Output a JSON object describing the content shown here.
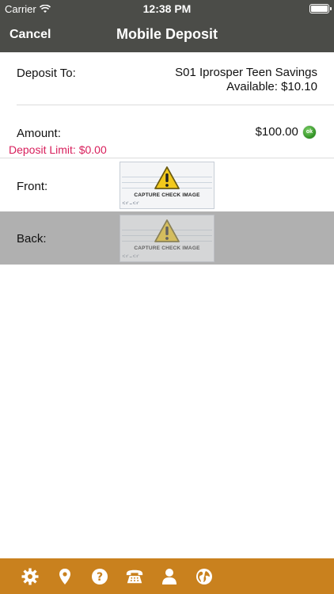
{
  "status": {
    "carrier": "Carrier",
    "time": "12:38 PM"
  },
  "nav": {
    "cancel_label": "Cancel",
    "title": "Mobile Deposit"
  },
  "deposit": {
    "label": "Deposit To:",
    "account": "S01 Iprosper Teen Savings",
    "available": "Available: $10.10"
  },
  "amount": {
    "label": "Amount:",
    "value": "$100.00",
    "ok_label": "ok",
    "limit": "Deposit Limit: $0.00"
  },
  "front": {
    "label": "Front:",
    "image_caption": "CAPTURE CHECK IMAGE"
  },
  "back": {
    "label": "Back:",
    "image_caption": "CAPTURE CHECK IMAGE"
  },
  "tabbar": {
    "color": "#c9811e",
    "icons": [
      "gear-icon",
      "location-pin-icon",
      "help-icon",
      "phone-icon",
      "user-icon",
      "globe-icon"
    ]
  },
  "colors": {
    "bar": "#4b4c48",
    "limit": "#d81e5b",
    "selected_row": "#b0b0b0"
  }
}
